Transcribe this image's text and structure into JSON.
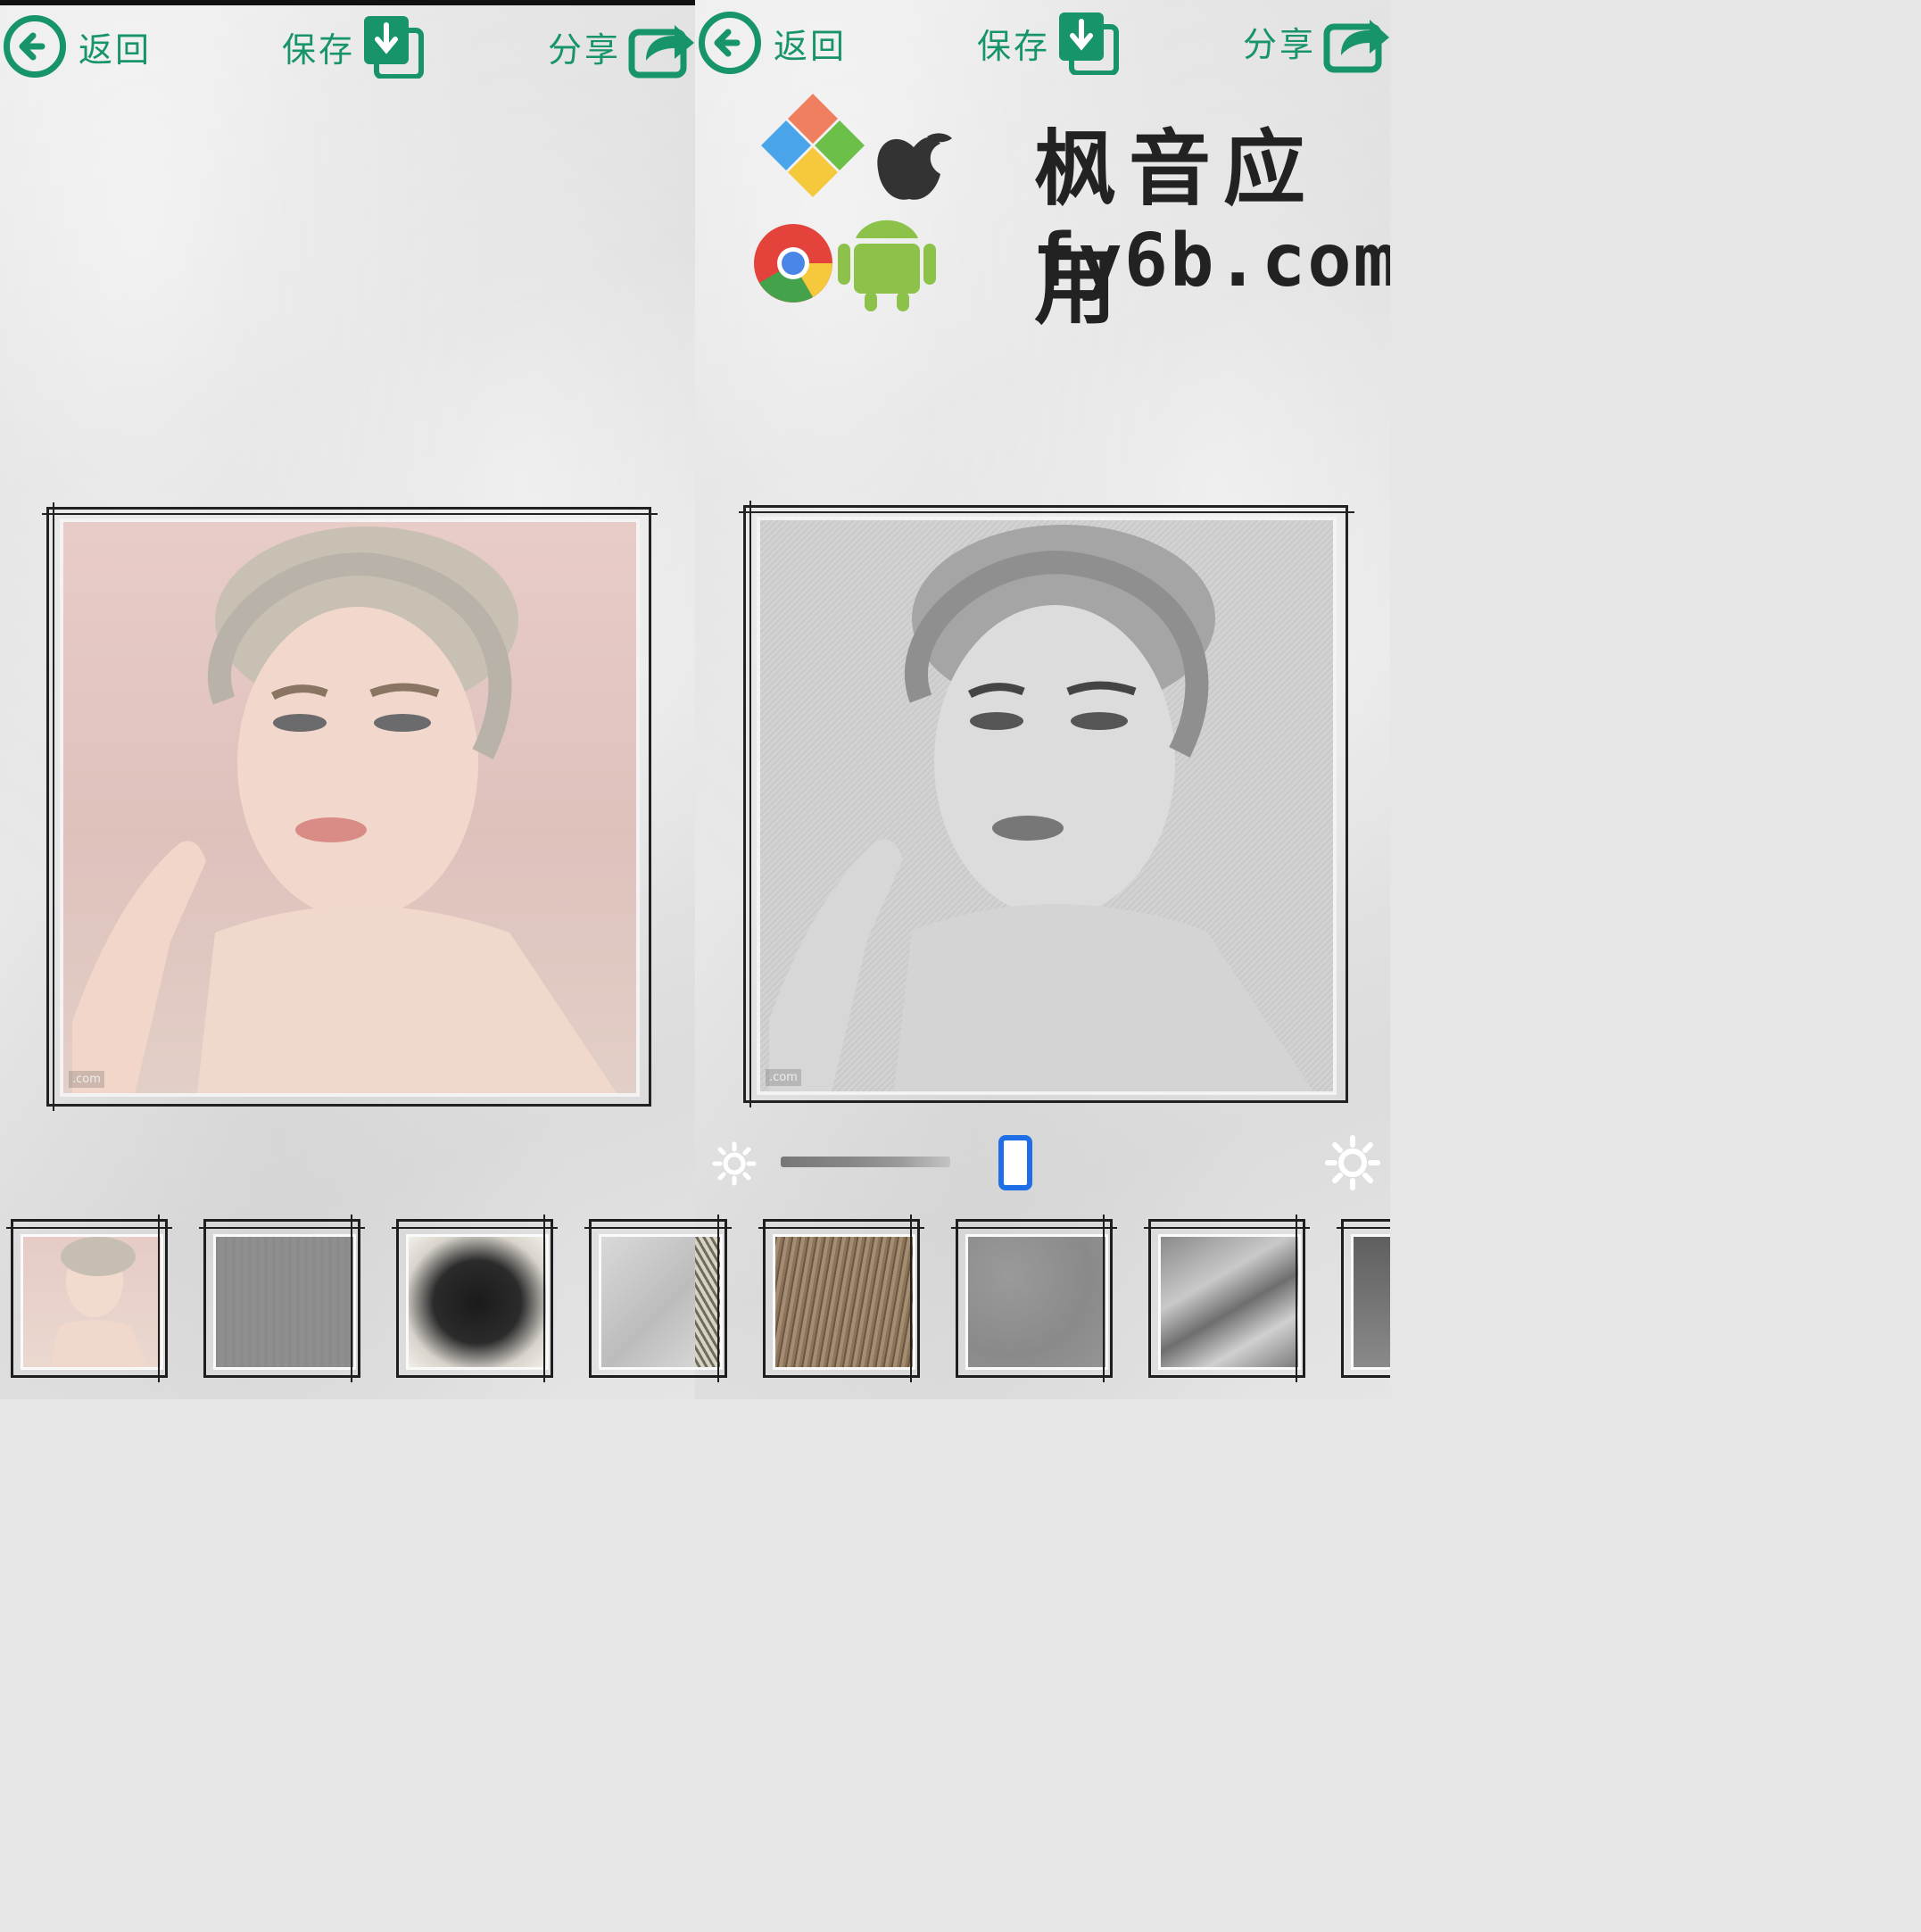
{
  "left_panel": {
    "toolbar": {
      "back_label": "返回",
      "save_label": "保存",
      "share_label": "分享"
    },
    "photo_mark": ".com"
  },
  "right_panel": {
    "toolbar": {
      "back_label": "返回",
      "save_label": "保存",
      "share_label": "分享"
    },
    "watermark": {
      "title": "枫音应用",
      "url": "fy6b.com"
    },
    "photo_mark": ".com",
    "slider": {
      "icon_left": "brightness-low-icon",
      "icon_right": "brightness-high-icon",
      "value_fraction": 0.45
    }
  },
  "colors": {
    "accent": "#17946a",
    "slider_handle": "#1e6fe6"
  },
  "thumbnails_left": [
    "original-photo",
    "gray-texture",
    "charcoal-scribble",
    "pencil-light"
  ],
  "thumbnails_right": [
    "brown-scribble",
    "gray-paper",
    "crumpled-sketch",
    "dark-texture"
  ]
}
